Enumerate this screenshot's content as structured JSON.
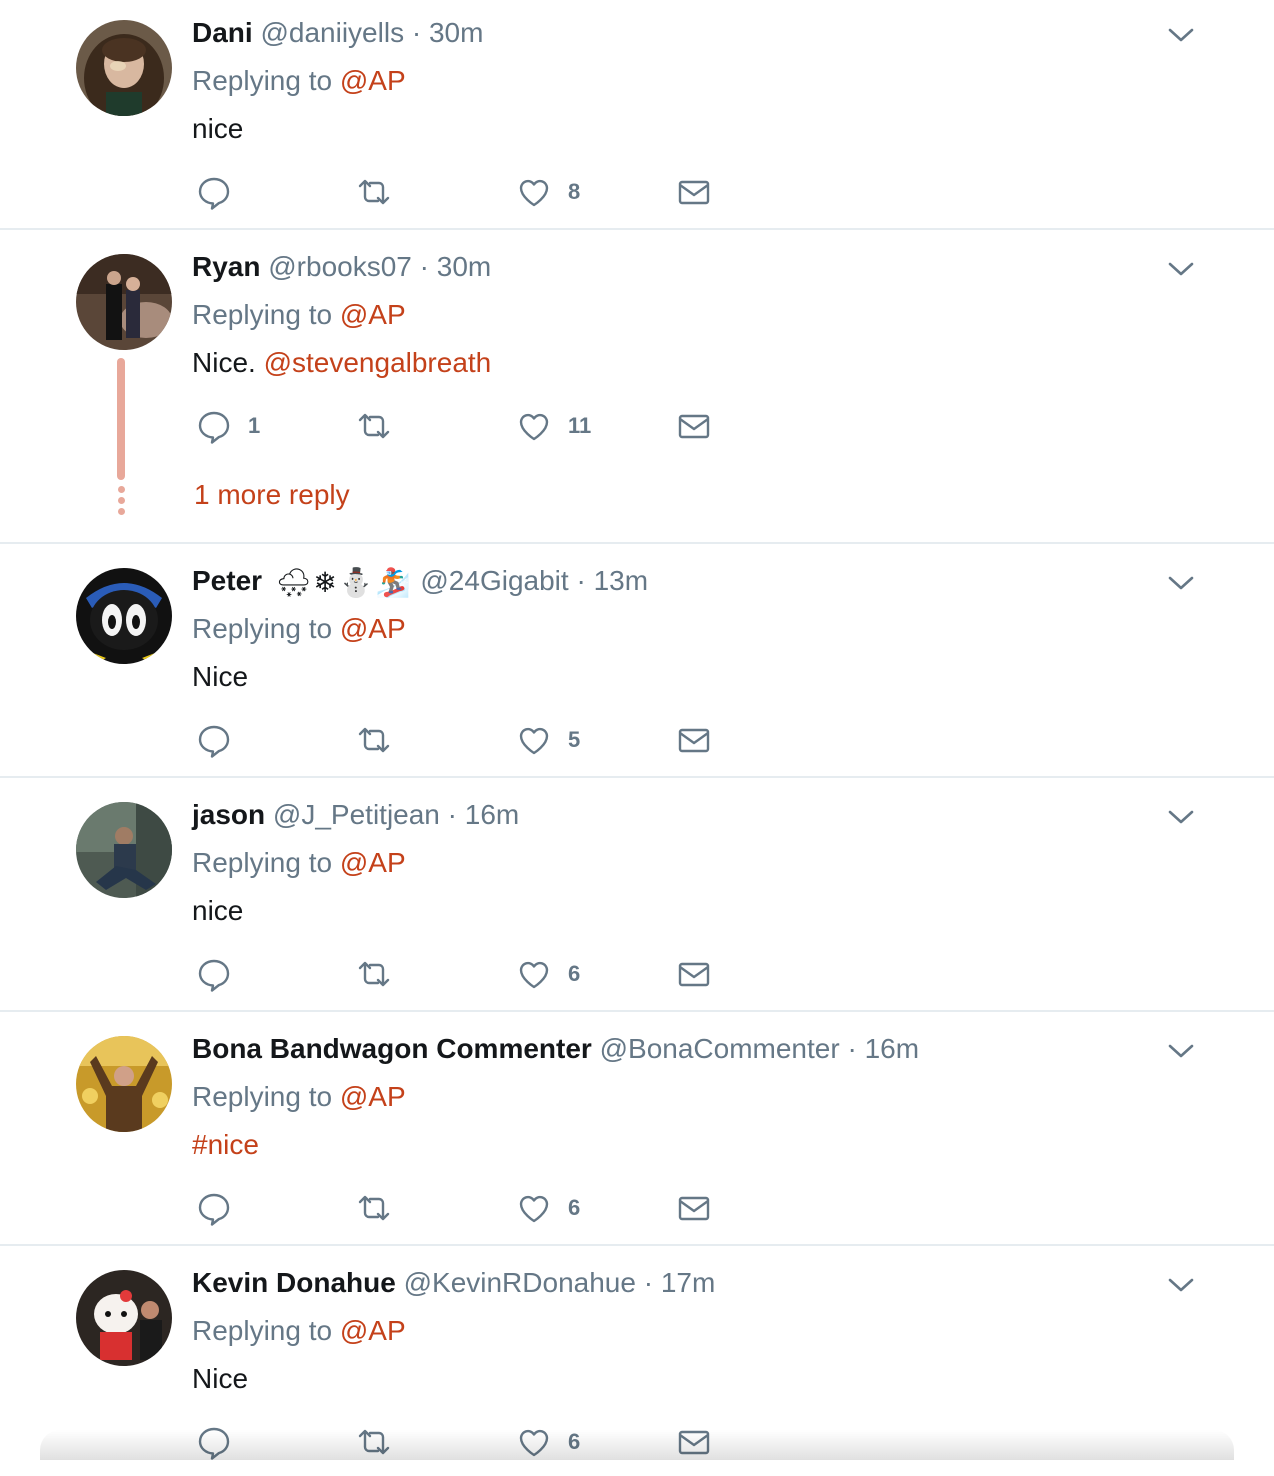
{
  "replying_prefix": "Replying to",
  "accent_color": "#c4411a",
  "icons": {
    "reply": "reply-icon",
    "retweet": "retweet-icon",
    "like": "heart-icon",
    "dm": "envelope-icon",
    "more": "chevron-down-icon"
  },
  "tweets": [
    {
      "name": "Dani",
      "handle": "@daniiyells",
      "time": "30m",
      "reply_to": "@AP",
      "text": "nice",
      "mention": "",
      "reply_count": "",
      "like_count": "8"
    },
    {
      "name": "Ryan",
      "handle": "@rbooks07",
      "time": "30m",
      "reply_to": "@AP",
      "text": "Nice.",
      "mention": "@stevengalbreath",
      "reply_count": "1",
      "like_count": "11",
      "more_replies": "1 more reply"
    },
    {
      "name": "Peter",
      "name_emojis": [
        "🌨",
        "❄",
        "⛄",
        "🏂"
      ],
      "handle": "@24Gigabit",
      "time": "13m",
      "reply_to": "@AP",
      "text": "Nice",
      "mention": "",
      "reply_count": "",
      "like_count": "5"
    },
    {
      "name": "jason",
      "handle": "@J_Petitjean",
      "time": "16m",
      "reply_to": "@AP",
      "text": "nice",
      "mention": "",
      "reply_count": "",
      "like_count": "6"
    },
    {
      "name": "Bona Bandwagon Commenter",
      "handle": "@BonaCommenter",
      "time": "16m",
      "reply_to": "@AP",
      "text": "",
      "mention": "#nice",
      "reply_count": "",
      "like_count": "6"
    },
    {
      "name": "Kevin Donahue",
      "handle": "@KevinRDonahue",
      "time": "17m",
      "reply_to": "@AP",
      "text": "Nice",
      "mention": "",
      "reply_count": "",
      "like_count": "6"
    }
  ]
}
